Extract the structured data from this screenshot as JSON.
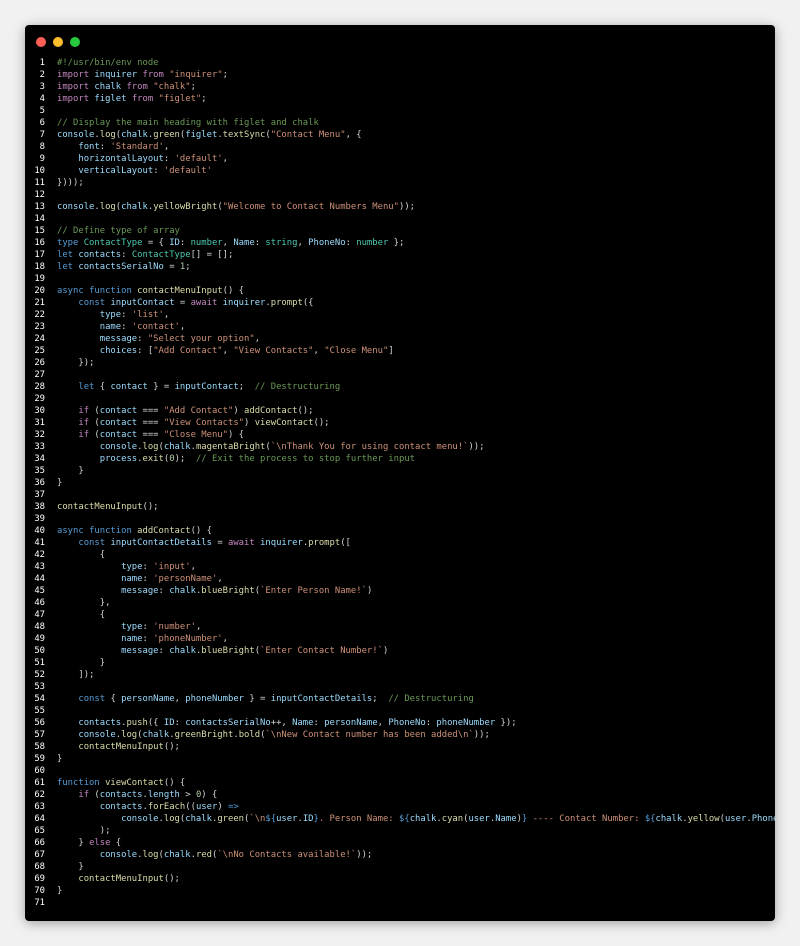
{
  "window": {
    "dots": [
      {
        "name": "close-dot",
        "color": "#ff5f56"
      },
      {
        "name": "minimize-dot",
        "color": "#ffbd2e"
      },
      {
        "name": "maximize-dot",
        "color": "#27c93f"
      }
    ]
  },
  "colors": {
    "com": "#6a9955",
    "kw": "#c586c0",
    "decl": "#569cd6",
    "str": "#ce9178",
    "fn": "#dcdcaa",
    "var": "#9cdcfe",
    "type": "#4ec9b0",
    "num": "#b5cea8",
    "punc": "#d4d4d4"
  },
  "code": [
    [
      [
        "com",
        "#!/usr/bin/env node"
      ]
    ],
    [
      [
        "kw",
        "import "
      ],
      [
        "var",
        "inquirer "
      ],
      [
        "kw",
        "from "
      ],
      [
        "str",
        "\"inquirer\""
      ],
      [
        "punc",
        ";"
      ]
    ],
    [
      [
        "kw",
        "import "
      ],
      [
        "var",
        "chalk "
      ],
      [
        "kw",
        "from "
      ],
      [
        "str",
        "\"chalk\""
      ],
      [
        "punc",
        ";"
      ]
    ],
    [
      [
        "kw",
        "import "
      ],
      [
        "var",
        "figlet "
      ],
      [
        "kw",
        "from "
      ],
      [
        "str",
        "\"figlet\""
      ],
      [
        "punc",
        ";"
      ]
    ],
    [],
    [
      [
        "com",
        "// Display the main heading with figlet and chalk"
      ]
    ],
    [
      [
        "var",
        "console"
      ],
      [
        "punc",
        "."
      ],
      [
        "fn",
        "log"
      ],
      [
        "punc",
        "("
      ],
      [
        "var",
        "chalk"
      ],
      [
        "punc",
        "."
      ],
      [
        "fn",
        "green"
      ],
      [
        "punc",
        "("
      ],
      [
        "var",
        "figlet"
      ],
      [
        "punc",
        "."
      ],
      [
        "fn",
        "textSync"
      ],
      [
        "punc",
        "("
      ],
      [
        "str",
        "\"Contact Menu\""
      ],
      [
        "punc",
        ", {"
      ]
    ],
    [
      [
        "punc",
        "    "
      ],
      [
        "var",
        "font"
      ],
      [
        "punc",
        ": "
      ],
      [
        "str",
        "'Standard'"
      ],
      [
        "punc",
        ","
      ]
    ],
    [
      [
        "punc",
        "    "
      ],
      [
        "var",
        "horizontalLayout"
      ],
      [
        "punc",
        ": "
      ],
      [
        "str",
        "'default'"
      ],
      [
        "punc",
        ","
      ]
    ],
    [
      [
        "punc",
        "    "
      ],
      [
        "var",
        "verticalLayout"
      ],
      [
        "punc",
        ": "
      ],
      [
        "str",
        "'default'"
      ]
    ],
    [
      [
        "punc",
        "})));"
      ]
    ],
    [],
    [
      [
        "var",
        "console"
      ],
      [
        "punc",
        "."
      ],
      [
        "fn",
        "log"
      ],
      [
        "punc",
        "("
      ],
      [
        "var",
        "chalk"
      ],
      [
        "punc",
        "."
      ],
      [
        "fn",
        "yellowBright"
      ],
      [
        "punc",
        "("
      ],
      [
        "str",
        "\"Welcome to Contact Numbers Menu\""
      ],
      [
        "punc",
        "));"
      ]
    ],
    [],
    [
      [
        "com",
        "// Define type of array"
      ]
    ],
    [
      [
        "decl",
        "type "
      ],
      [
        "type",
        "ContactType "
      ],
      [
        "punc",
        "= { "
      ],
      [
        "var",
        "ID"
      ],
      [
        "punc",
        ": "
      ],
      [
        "type",
        "number"
      ],
      [
        "punc",
        ", "
      ],
      [
        "var",
        "Name"
      ],
      [
        "punc",
        ": "
      ],
      [
        "type",
        "string"
      ],
      [
        "punc",
        ", "
      ],
      [
        "var",
        "PhoneNo"
      ],
      [
        "punc",
        ": "
      ],
      [
        "type",
        "number "
      ],
      [
        "punc",
        "};"
      ]
    ],
    [
      [
        "decl",
        "let "
      ],
      [
        "var",
        "contacts"
      ],
      [
        "punc",
        ": "
      ],
      [
        "type",
        "ContactType"
      ],
      [
        "punc",
        "[] = [];"
      ]
    ],
    [
      [
        "decl",
        "let "
      ],
      [
        "var",
        "contactsSerialNo "
      ],
      [
        "punc",
        "= "
      ],
      [
        "num",
        "1"
      ],
      [
        "punc",
        ";"
      ]
    ],
    [],
    [
      [
        "decl",
        "async "
      ],
      [
        "decl",
        "function "
      ],
      [
        "fn",
        "contactMenuInput"
      ],
      [
        "punc",
        "() {"
      ]
    ],
    [
      [
        "punc",
        "    "
      ],
      [
        "decl",
        "const "
      ],
      [
        "var",
        "inputContact "
      ],
      [
        "punc",
        "= "
      ],
      [
        "kw",
        "await "
      ],
      [
        "var",
        "inquirer"
      ],
      [
        "punc",
        "."
      ],
      [
        "fn",
        "prompt"
      ],
      [
        "punc",
        "({"
      ]
    ],
    [
      [
        "punc",
        "        "
      ],
      [
        "var",
        "type"
      ],
      [
        "punc",
        ": "
      ],
      [
        "str",
        "'list'"
      ],
      [
        "punc",
        ","
      ]
    ],
    [
      [
        "punc",
        "        "
      ],
      [
        "var",
        "name"
      ],
      [
        "punc",
        ": "
      ],
      [
        "str",
        "'contact'"
      ],
      [
        "punc",
        ","
      ]
    ],
    [
      [
        "punc",
        "        "
      ],
      [
        "var",
        "message"
      ],
      [
        "punc",
        ": "
      ],
      [
        "str",
        "\"Select your option\""
      ],
      [
        "punc",
        ","
      ]
    ],
    [
      [
        "punc",
        "        "
      ],
      [
        "var",
        "choices"
      ],
      [
        "punc",
        ": ["
      ],
      [
        "str",
        "\"Add Contact\""
      ],
      [
        "punc",
        ", "
      ],
      [
        "str",
        "\"View Contacts\""
      ],
      [
        "punc",
        ", "
      ],
      [
        "str",
        "\"Close Menu\""
      ],
      [
        "punc",
        "]"
      ]
    ],
    [
      [
        "punc",
        "    });"
      ]
    ],
    [],
    [
      [
        "punc",
        "    "
      ],
      [
        "decl",
        "let "
      ],
      [
        "punc",
        "{ "
      ],
      [
        "var",
        "contact "
      ],
      [
        "punc",
        "} = "
      ],
      [
        "var",
        "inputContact"
      ],
      [
        "punc",
        ";  "
      ],
      [
        "com",
        "// Destructuring"
      ]
    ],
    [],
    [
      [
        "punc",
        "    "
      ],
      [
        "kw",
        "if "
      ],
      [
        "punc",
        "("
      ],
      [
        "var",
        "contact "
      ],
      [
        "punc",
        "=== "
      ],
      [
        "str",
        "\"Add Contact\""
      ],
      [
        "punc",
        ") "
      ],
      [
        "fn",
        "addContact"
      ],
      [
        "punc",
        "();"
      ]
    ],
    [
      [
        "punc",
        "    "
      ],
      [
        "kw",
        "if "
      ],
      [
        "punc",
        "("
      ],
      [
        "var",
        "contact "
      ],
      [
        "punc",
        "=== "
      ],
      [
        "str",
        "\"View Contacts\""
      ],
      [
        "punc",
        ") "
      ],
      [
        "fn",
        "viewContact"
      ],
      [
        "punc",
        "();"
      ]
    ],
    [
      [
        "punc",
        "    "
      ],
      [
        "kw",
        "if "
      ],
      [
        "punc",
        "("
      ],
      [
        "var",
        "contact "
      ],
      [
        "punc",
        "=== "
      ],
      [
        "str",
        "\"Close Menu\""
      ],
      [
        "punc",
        ") {"
      ]
    ],
    [
      [
        "punc",
        "        "
      ],
      [
        "var",
        "console"
      ],
      [
        "punc",
        "."
      ],
      [
        "fn",
        "log"
      ],
      [
        "punc",
        "("
      ],
      [
        "var",
        "chalk"
      ],
      [
        "punc",
        "."
      ],
      [
        "fn",
        "magentaBright"
      ],
      [
        "punc",
        "("
      ],
      [
        "str",
        "`\\nThank You for using contact menu!`"
      ],
      [
        "punc",
        "));"
      ]
    ],
    [
      [
        "punc",
        "        "
      ],
      [
        "var",
        "process"
      ],
      [
        "punc",
        "."
      ],
      [
        "fn",
        "exit"
      ],
      [
        "punc",
        "("
      ],
      [
        "num",
        "0"
      ],
      [
        "punc",
        ");  "
      ],
      [
        "com",
        "// Exit the process to stop further input"
      ]
    ],
    [
      [
        "punc",
        "    }"
      ]
    ],
    [
      [
        "punc",
        "}"
      ]
    ],
    [],
    [
      [
        "fn",
        "contactMenuInput"
      ],
      [
        "punc",
        "();"
      ]
    ],
    [],
    [
      [
        "decl",
        "async "
      ],
      [
        "decl",
        "function "
      ],
      [
        "fn",
        "addContact"
      ],
      [
        "punc",
        "() {"
      ]
    ],
    [
      [
        "punc",
        "    "
      ],
      [
        "decl",
        "const "
      ],
      [
        "var",
        "inputContactDetails "
      ],
      [
        "punc",
        "= "
      ],
      [
        "kw",
        "await "
      ],
      [
        "var",
        "inquirer"
      ],
      [
        "punc",
        "."
      ],
      [
        "fn",
        "prompt"
      ],
      [
        "punc",
        "(["
      ]
    ],
    [
      [
        "punc",
        "        {"
      ]
    ],
    [
      [
        "punc",
        "            "
      ],
      [
        "var",
        "type"
      ],
      [
        "punc",
        ": "
      ],
      [
        "str",
        "'input'"
      ],
      [
        "punc",
        ","
      ]
    ],
    [
      [
        "punc",
        "            "
      ],
      [
        "var",
        "name"
      ],
      [
        "punc",
        ": "
      ],
      [
        "str",
        "'personName'"
      ],
      [
        "punc",
        ","
      ]
    ],
    [
      [
        "punc",
        "            "
      ],
      [
        "var",
        "message"
      ],
      [
        "punc",
        ": "
      ],
      [
        "var",
        "chalk"
      ],
      [
        "punc",
        "."
      ],
      [
        "fn",
        "blueBright"
      ],
      [
        "punc",
        "("
      ],
      [
        "str",
        "`Enter Person Name!`"
      ],
      [
        "punc",
        ")"
      ]
    ],
    [
      [
        "punc",
        "        },"
      ]
    ],
    [
      [
        "punc",
        "        {"
      ]
    ],
    [
      [
        "punc",
        "            "
      ],
      [
        "var",
        "type"
      ],
      [
        "punc",
        ": "
      ],
      [
        "str",
        "'number'"
      ],
      [
        "punc",
        ","
      ]
    ],
    [
      [
        "punc",
        "            "
      ],
      [
        "var",
        "name"
      ],
      [
        "punc",
        ": "
      ],
      [
        "str",
        "'phoneNumber'"
      ],
      [
        "punc",
        ","
      ]
    ],
    [
      [
        "punc",
        "            "
      ],
      [
        "var",
        "message"
      ],
      [
        "punc",
        ": "
      ],
      [
        "var",
        "chalk"
      ],
      [
        "punc",
        "."
      ],
      [
        "fn",
        "blueBright"
      ],
      [
        "punc",
        "("
      ],
      [
        "str",
        "`Enter Contact Number!`"
      ],
      [
        "punc",
        ")"
      ]
    ],
    [
      [
        "punc",
        "        }"
      ]
    ],
    [
      [
        "punc",
        "    ]);"
      ]
    ],
    [],
    [
      [
        "punc",
        "    "
      ],
      [
        "decl",
        "const "
      ],
      [
        "punc",
        "{ "
      ],
      [
        "var",
        "personName"
      ],
      [
        "punc",
        ", "
      ],
      [
        "var",
        "phoneNumber "
      ],
      [
        "punc",
        "} = "
      ],
      [
        "var",
        "inputContactDetails"
      ],
      [
        "punc",
        ";  "
      ],
      [
        "com",
        "// Destructuring"
      ]
    ],
    [],
    [
      [
        "punc",
        "    "
      ],
      [
        "var",
        "contacts"
      ],
      [
        "punc",
        "."
      ],
      [
        "fn",
        "push"
      ],
      [
        "punc",
        "({ "
      ],
      [
        "var",
        "ID"
      ],
      [
        "punc",
        ": "
      ],
      [
        "var",
        "contactsSerialNo"
      ],
      [
        "punc",
        "++, "
      ],
      [
        "var",
        "Name"
      ],
      [
        "punc",
        ": "
      ],
      [
        "var",
        "personName"
      ],
      [
        "punc",
        ", "
      ],
      [
        "var",
        "PhoneNo"
      ],
      [
        "punc",
        ": "
      ],
      [
        "var",
        "phoneNumber "
      ],
      [
        "punc",
        "});"
      ]
    ],
    [
      [
        "punc",
        "    "
      ],
      [
        "var",
        "console"
      ],
      [
        "punc",
        "."
      ],
      [
        "fn",
        "log"
      ],
      [
        "punc",
        "("
      ],
      [
        "var",
        "chalk"
      ],
      [
        "punc",
        "."
      ],
      [
        "fn",
        "greenBright"
      ],
      [
        "punc",
        "."
      ],
      [
        "fn",
        "bold"
      ],
      [
        "punc",
        "("
      ],
      [
        "str",
        "`\\nNew Contact number has been added\\n`"
      ],
      [
        "punc",
        "));"
      ]
    ],
    [
      [
        "punc",
        "    "
      ],
      [
        "fn",
        "contactMenuInput"
      ],
      [
        "punc",
        "();"
      ]
    ],
    [
      [
        "punc",
        "}"
      ]
    ],
    [],
    [
      [
        "decl",
        "function "
      ],
      [
        "fn",
        "viewContact"
      ],
      [
        "punc",
        "() {"
      ]
    ],
    [
      [
        "punc",
        "    "
      ],
      [
        "kw",
        "if "
      ],
      [
        "punc",
        "("
      ],
      [
        "var",
        "contacts"
      ],
      [
        "punc",
        "."
      ],
      [
        "var",
        "length "
      ],
      [
        "punc",
        "> "
      ],
      [
        "num",
        "0"
      ],
      [
        "punc",
        ") {"
      ]
    ],
    [
      [
        "punc",
        "        "
      ],
      [
        "var",
        "contacts"
      ],
      [
        "punc",
        "."
      ],
      [
        "fn",
        "forEach"
      ],
      [
        "punc",
        "(("
      ],
      [
        "var",
        "user"
      ],
      [
        "punc",
        ") "
      ],
      [
        "decl",
        "=>"
      ]
    ],
    [
      [
        "punc",
        "            "
      ],
      [
        "var",
        "console"
      ],
      [
        "punc",
        "."
      ],
      [
        "fn",
        "log"
      ],
      [
        "punc",
        "("
      ],
      [
        "var",
        "chalk"
      ],
      [
        "punc",
        "."
      ],
      [
        "fn",
        "green"
      ],
      [
        "punc",
        "("
      ],
      [
        "str",
        "`\\n"
      ],
      [
        "decl",
        "${"
      ],
      [
        "var",
        "user"
      ],
      [
        "punc",
        "."
      ],
      [
        "var",
        "ID"
      ],
      [
        "decl",
        "}"
      ],
      [
        "str",
        ". Person Name: "
      ],
      [
        "decl",
        "${"
      ],
      [
        "var",
        "chalk"
      ],
      [
        "punc",
        "."
      ],
      [
        "fn",
        "cyan"
      ],
      [
        "punc",
        "("
      ],
      [
        "var",
        "user"
      ],
      [
        "punc",
        "."
      ],
      [
        "var",
        "Name"
      ],
      [
        "punc",
        ")"
      ],
      [
        "decl",
        "}"
      ],
      [
        "str",
        " ---- Contact Number: "
      ],
      [
        "decl",
        "${"
      ],
      [
        "var",
        "chalk"
      ],
      [
        "punc",
        "."
      ],
      [
        "fn",
        "yellow"
      ],
      [
        "punc",
        "("
      ],
      [
        "var",
        "user"
      ],
      [
        "punc",
        "."
      ],
      [
        "var",
        "PhoneNo"
      ],
      [
        "punc",
        ")"
      ],
      [
        "decl",
        "}"
      ],
      [
        "str",
        "\\n`"
      ],
      [
        "punc",
        "))"
      ]
    ],
    [
      [
        "punc",
        "        );"
      ]
    ],
    [
      [
        "punc",
        "    } "
      ],
      [
        "kw",
        "else "
      ],
      [
        "punc",
        "{"
      ]
    ],
    [
      [
        "punc",
        "        "
      ],
      [
        "var",
        "console"
      ],
      [
        "punc",
        "."
      ],
      [
        "fn",
        "log"
      ],
      [
        "punc",
        "("
      ],
      [
        "var",
        "chalk"
      ],
      [
        "punc",
        "."
      ],
      [
        "fn",
        "red"
      ],
      [
        "punc",
        "("
      ],
      [
        "str",
        "`\\nNo Contacts available!`"
      ],
      [
        "punc",
        "));"
      ]
    ],
    [
      [
        "punc",
        "    }"
      ]
    ],
    [
      [
        "punc",
        "    "
      ],
      [
        "fn",
        "contactMenuInput"
      ],
      [
        "punc",
        "();"
      ]
    ],
    [
      [
        "punc",
        "}"
      ]
    ],
    []
  ]
}
